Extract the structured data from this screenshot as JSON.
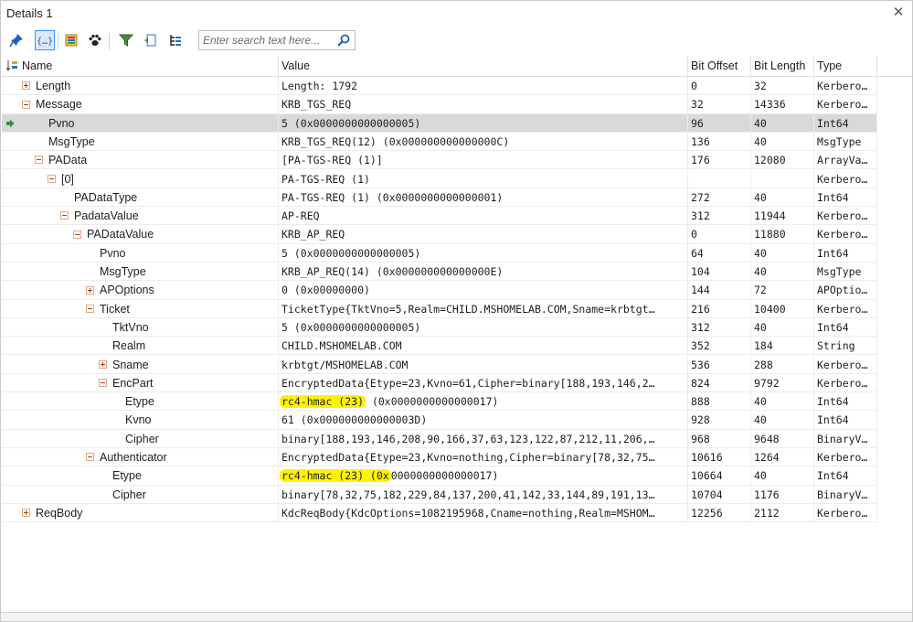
{
  "window": {
    "title": "Details 1"
  },
  "toolbar": {
    "buttons": [
      {
        "icon": "pin-icon",
        "active": false
      },
      {
        "icon": "braces-icon",
        "active": true
      },
      {
        "icon": "layout-icon",
        "active": false
      },
      {
        "icon": "paw-icon",
        "active": false
      },
      {
        "icon": "filter-icon",
        "active": false
      },
      {
        "icon": "export-icon",
        "active": false
      },
      {
        "icon": "list-icon",
        "active": false
      }
    ],
    "search": {
      "placeholder": "Enter search text here...",
      "value": ""
    }
  },
  "grid": {
    "columns": [
      "Name",
      "Value",
      "Bit Offset",
      "Bit Length",
      "Type"
    ],
    "rows": [
      {
        "depth": 0,
        "toggle": "plus",
        "name": "Length",
        "value": "Length: 1792",
        "offset": "0",
        "length": "32",
        "type": "Kerbero…"
      },
      {
        "depth": 0,
        "toggle": "minus",
        "name": "Message",
        "value": "KRB_TGS_REQ",
        "offset": "32",
        "length": "14336",
        "type": "Kerbero…"
      },
      {
        "depth": 1,
        "toggle": "none",
        "name": "Pvno",
        "value": "5 (0x0000000000000005)",
        "offset": "96",
        "length": "40",
        "type": "Int64",
        "selected": true
      },
      {
        "depth": 1,
        "toggle": "none",
        "name": "MsgType",
        "value": "KRB_TGS_REQ(12) (0x000000000000000C)",
        "offset": "136",
        "length": "40",
        "type": "MsgType"
      },
      {
        "depth": 1,
        "toggle": "minus",
        "name": "PAData",
        "value": "[PA-TGS-REQ (1)]",
        "offset": "176",
        "length": "12080",
        "type": "ArrayVa…"
      },
      {
        "depth": 2,
        "toggle": "minus",
        "name": "[0]",
        "value": "PA-TGS-REQ (1)",
        "offset": "",
        "length": "",
        "type": "Kerbero…"
      },
      {
        "depth": 3,
        "toggle": "none",
        "name": "PADataType",
        "value": "PA-TGS-REQ (1) (0x0000000000000001)",
        "offset": "272",
        "length": "40",
        "type": "Int64"
      },
      {
        "depth": 3,
        "toggle": "minus",
        "name": "PadataValue",
        "value": "AP-REQ",
        "offset": "312",
        "length": "11944",
        "type": "Kerbero…"
      },
      {
        "depth": 4,
        "toggle": "minus",
        "name": "PADataValue",
        "value": "KRB_AP_REQ",
        "offset": "0",
        "length": "11880",
        "type": "Kerbero…"
      },
      {
        "depth": 5,
        "toggle": "none",
        "name": "Pvno",
        "value": "5 (0x0000000000000005)",
        "offset": "64",
        "length": "40",
        "type": "Int64"
      },
      {
        "depth": 5,
        "toggle": "none",
        "name": "MsgType",
        "value": "KRB_AP_REQ(14) (0x000000000000000E)",
        "offset": "104",
        "length": "40",
        "type": "MsgType"
      },
      {
        "depth": 5,
        "toggle": "plus",
        "name": "APOptions",
        "value": "0 (0x00000000)",
        "offset": "144",
        "length": "72",
        "type": "APOptio…"
      },
      {
        "depth": 5,
        "toggle": "minus",
        "name": "Ticket",
        "value": "TicketType{TktVno=5,Realm=CHILD.MSHOMELAB.COM,Sname=krbtgt…",
        "offset": "216",
        "length": "10400",
        "type": "Kerbero…"
      },
      {
        "depth": 6,
        "toggle": "none",
        "name": "TktVno",
        "value": "5 (0x0000000000000005)",
        "offset": "312",
        "length": "40",
        "type": "Int64"
      },
      {
        "depth": 6,
        "toggle": "none",
        "name": "Realm",
        "value": "CHILD.MSHOMELAB.COM",
        "offset": "352",
        "length": "184",
        "type": "String"
      },
      {
        "depth": 6,
        "toggle": "plus",
        "name": "Sname",
        "value": "krbtgt/MSHOMELAB.COM",
        "offset": "536",
        "length": "288",
        "type": "Kerbero…"
      },
      {
        "depth": 6,
        "toggle": "minus",
        "name": "EncPart",
        "value": "EncryptedData{Etype=23,Kvno=61,Cipher=binary[188,193,146,2…",
        "offset": "824",
        "length": "9792",
        "type": "Kerbero…"
      },
      {
        "depth": 7,
        "toggle": "none",
        "name": "Etype",
        "value_hl": "rc4-hmac (23)",
        "value_rest": " (0x0000000000000017)",
        "offset": "888",
        "length": "40",
        "type": "Int64"
      },
      {
        "depth": 7,
        "toggle": "none",
        "name": "Kvno",
        "value": "61 (0x000000000000003D)",
        "offset": "928",
        "length": "40",
        "type": "Int64"
      },
      {
        "depth": 7,
        "toggle": "none",
        "name": "Cipher",
        "value": "binary[188,193,146,208,90,166,37,63,123,122,87,212,11,206,…",
        "offset": "968",
        "length": "9648",
        "type": "BinaryV…"
      },
      {
        "depth": 5,
        "toggle": "minus",
        "name": "Authenticator",
        "value": "EncryptedData{Etype=23,Kvno=nothing,Cipher=binary[78,32,75…",
        "offset": "10616",
        "length": "1264",
        "type": "Kerbero…"
      },
      {
        "depth": 6,
        "toggle": "none",
        "name": "Etype",
        "value_hl": "rc4-hmac (23) (0x",
        "value_rest": "0000000000000017)",
        "offset": "10664",
        "length": "40",
        "type": "Int64"
      },
      {
        "depth": 6,
        "toggle": "none",
        "name": "Cipher",
        "value": "binary[78,32,75,182,229,84,137,200,41,142,33,144,89,191,13…",
        "offset": "10704",
        "length": "1176",
        "type": "BinaryV…"
      },
      {
        "depth": 0,
        "toggle": "plus",
        "name": "ReqBody",
        "value": "KdcReqBody{KdcOptions=1082195968,Cname=nothing,Realm=MSHOM…",
        "offset": "12256",
        "length": "2112",
        "type": "Kerbero…"
      }
    ]
  }
}
